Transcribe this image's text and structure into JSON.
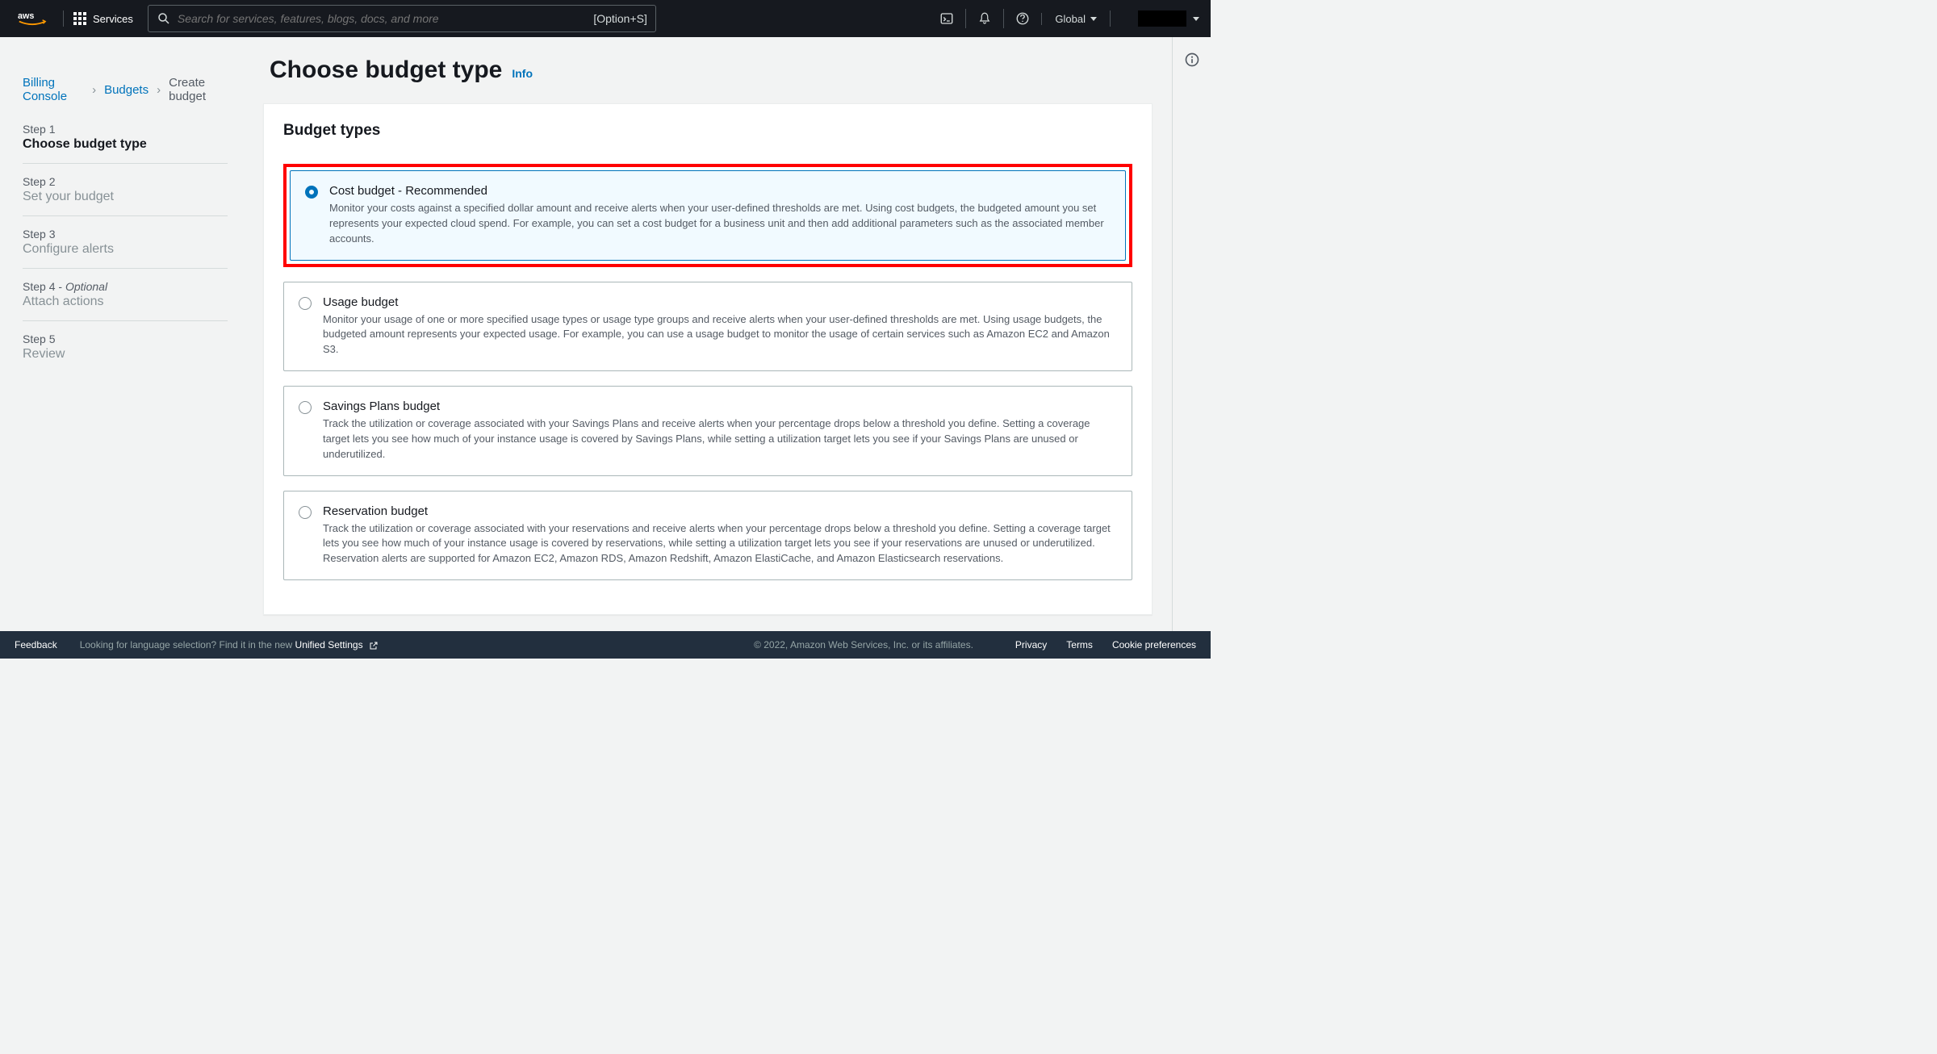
{
  "nav": {
    "services_label": "Services",
    "search_placeholder": "Search for services, features, blogs, docs, and more",
    "search_shortcut": "[Option+S]",
    "region": "Global"
  },
  "breadcrumbs": {
    "a": "Billing Console",
    "b": "Budgets",
    "current": "Create budget"
  },
  "steps": [
    {
      "label": "Step 1",
      "name": "Choose budget type",
      "active": true
    },
    {
      "label": "Step 2",
      "name": "Set your budget"
    },
    {
      "label": "Step 3",
      "name": "Configure alerts"
    },
    {
      "label": "Step 4",
      "optional": "Optional",
      "name": "Attach actions"
    },
    {
      "label": "Step 5",
      "name": "Review"
    }
  ],
  "page": {
    "title": "Choose budget type",
    "info": "Info",
    "card_header": "Budget types"
  },
  "options": [
    {
      "title": "Cost budget - Recommended",
      "desc": "Monitor your costs against a specified dollar amount and receive alerts when your user-defined thresholds are met. Using cost budgets, the budgeted amount you set represents your expected cloud spend. For example, you can set a cost budget for a business unit and then add additional parameters such as the associated member accounts.",
      "selected": true,
      "highlight": true
    },
    {
      "title": "Usage budget",
      "desc": "Monitor your usage of one or more specified usage types or usage type groups and receive alerts when your user-defined thresholds are met. Using usage budgets, the budgeted amount represents your expected usage. For example, you can use a usage budget to monitor the usage of certain services such as Amazon EC2 and Amazon S3."
    },
    {
      "title": "Savings Plans budget",
      "desc": "Track the utilization or coverage associated with your Savings Plans and receive alerts when your percentage drops below a threshold you define. Setting a coverage target lets you see how much of your instance usage is covered by Savings Plans, while setting a utilization target lets you see if your Savings Plans are unused or underutilized."
    },
    {
      "title": "Reservation budget",
      "desc": "Track the utilization or coverage associated with your reservations and receive alerts when your percentage drops below a threshold you define. Setting a coverage target lets you see how much of your instance usage is covered by reservations, while setting a utilization target lets you see if your reservations are unused or underutilized. Reservation alerts are supported for Amazon EC2, Amazon RDS, Amazon Redshift, Amazon ElastiCache, and Amazon Elasticsearch reservations."
    }
  ],
  "footer": {
    "feedback": "Feedback",
    "lang_prefix": "Looking for language selection? Find it in the new ",
    "lang_link": "Unified Settings",
    "copyright": "© 2022, Amazon Web Services, Inc. or its affiliates.",
    "privacy": "Privacy",
    "terms": "Terms",
    "cookies": "Cookie preferences"
  }
}
